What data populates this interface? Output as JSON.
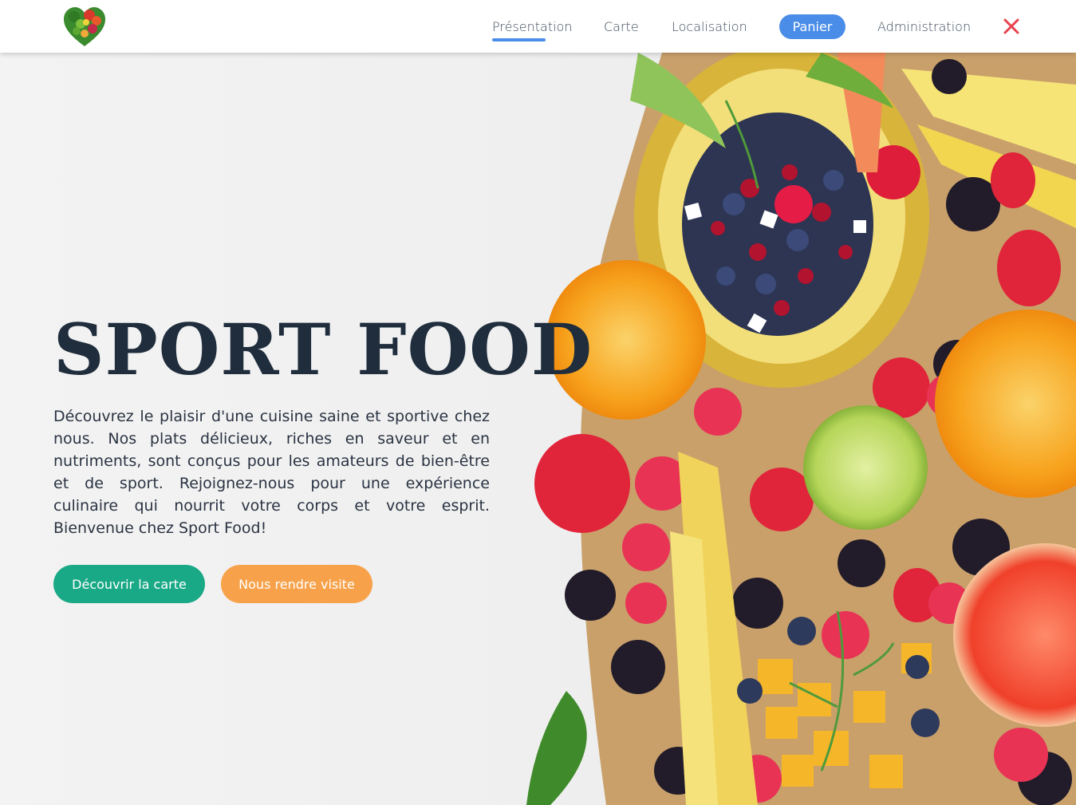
{
  "header": {
    "logo_icon": "heart-fruit-logo-icon",
    "nav": [
      {
        "label": "Présentation",
        "active": true
      },
      {
        "label": "Carte"
      },
      {
        "label": "Localisation"
      },
      {
        "label": "Panier",
        "highlight": true
      },
      {
        "label": "Administration"
      }
    ],
    "close_icon": "close-icon"
  },
  "hero": {
    "title": "SPORT FOOD",
    "description": "Découvrez le plaisir d'une cuisine saine et sportive chez nous. Nos plats délicieux, riches en saveur et en nutriments, sont conçus pour les amateurs de bien-être et de sport. Rejoignez-nous pour une expérience culinaire qui nourrit votre corps et votre esprit. Bienvenue chez Sport Food!",
    "primary_button": "Découvrir la carte",
    "secondary_button": "Nous rendre visite",
    "image_icon": "fruit-platter-image"
  },
  "colors": {
    "accent_blue": "#4a8de8",
    "green": "#1aa986",
    "orange": "#f7a24a",
    "close_red": "#e8434f",
    "title": "#1f2d3d"
  }
}
